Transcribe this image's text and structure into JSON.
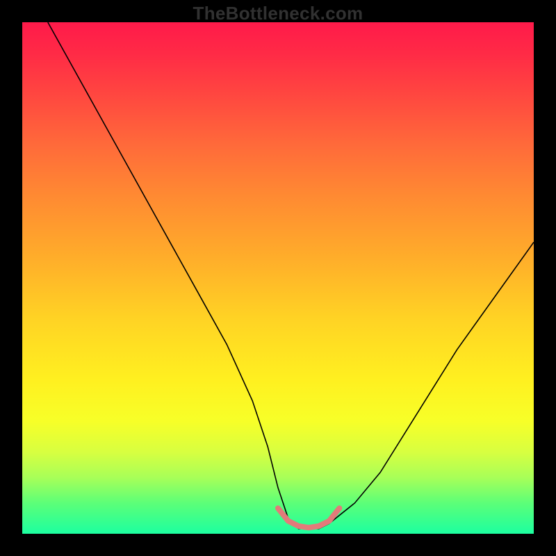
{
  "watermark": "TheBottleneck.com",
  "chart_data": {
    "type": "line",
    "title": "",
    "xlabel": "",
    "ylabel": "",
    "xlim": [
      0,
      100
    ],
    "ylim": [
      0,
      100
    ],
    "series": [
      {
        "name": "bottleneck-curve",
        "x": [
          5,
          10,
          15,
          20,
          25,
          30,
          35,
          40,
          45,
          48,
          50,
          52,
          54,
          56,
          58,
          60,
          65,
          70,
          75,
          80,
          85,
          90,
          95,
          100
        ],
        "y": [
          100,
          91,
          82,
          73,
          64,
          55,
          46,
          37,
          26,
          17,
          9,
          3,
          1,
          1,
          1,
          2,
          6,
          12,
          20,
          28,
          36,
          43,
          50,
          57
        ]
      }
    ],
    "highlight": {
      "name": "optimal-range",
      "x": [
        50,
        52,
        54,
        56,
        58,
        60,
        62
      ],
      "y": [
        5,
        2.5,
        1.5,
        1.2,
        1.5,
        2.5,
        5
      ]
    },
    "background_gradient": {
      "top": "#ff1a4a",
      "middle": "#ffd324",
      "bottom": "#1cffa0"
    }
  }
}
